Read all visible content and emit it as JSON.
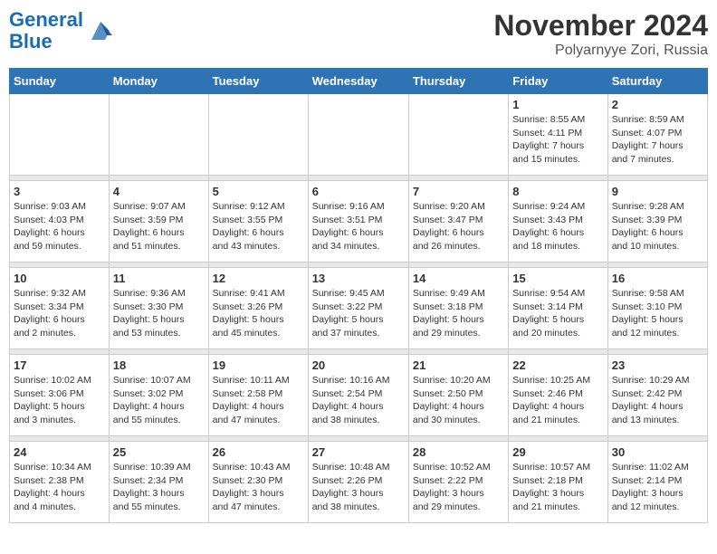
{
  "logo": {
    "line1": "General",
    "line2": "Blue"
  },
  "title": "November 2024",
  "location": "Polyarnyye Zori, Russia",
  "days_of_week": [
    "Sunday",
    "Monday",
    "Tuesday",
    "Wednesday",
    "Thursday",
    "Friday",
    "Saturday"
  ],
  "weeks": [
    [
      {
        "day": "",
        "info": ""
      },
      {
        "day": "",
        "info": ""
      },
      {
        "day": "",
        "info": ""
      },
      {
        "day": "",
        "info": ""
      },
      {
        "day": "",
        "info": ""
      },
      {
        "day": "1",
        "info": "Sunrise: 8:55 AM\nSunset: 4:11 PM\nDaylight: 7 hours\nand 15 minutes."
      },
      {
        "day": "2",
        "info": "Sunrise: 8:59 AM\nSunset: 4:07 PM\nDaylight: 7 hours\nand 7 minutes."
      }
    ],
    [
      {
        "day": "3",
        "info": "Sunrise: 9:03 AM\nSunset: 4:03 PM\nDaylight: 6 hours\nand 59 minutes."
      },
      {
        "day": "4",
        "info": "Sunrise: 9:07 AM\nSunset: 3:59 PM\nDaylight: 6 hours\nand 51 minutes."
      },
      {
        "day": "5",
        "info": "Sunrise: 9:12 AM\nSunset: 3:55 PM\nDaylight: 6 hours\nand 43 minutes."
      },
      {
        "day": "6",
        "info": "Sunrise: 9:16 AM\nSunset: 3:51 PM\nDaylight: 6 hours\nand 34 minutes."
      },
      {
        "day": "7",
        "info": "Sunrise: 9:20 AM\nSunset: 3:47 PM\nDaylight: 6 hours\nand 26 minutes."
      },
      {
        "day": "8",
        "info": "Sunrise: 9:24 AM\nSunset: 3:43 PM\nDaylight: 6 hours\nand 18 minutes."
      },
      {
        "day": "9",
        "info": "Sunrise: 9:28 AM\nSunset: 3:39 PM\nDaylight: 6 hours\nand 10 minutes."
      }
    ],
    [
      {
        "day": "10",
        "info": "Sunrise: 9:32 AM\nSunset: 3:34 PM\nDaylight: 6 hours\nand 2 minutes."
      },
      {
        "day": "11",
        "info": "Sunrise: 9:36 AM\nSunset: 3:30 PM\nDaylight: 5 hours\nand 53 minutes."
      },
      {
        "day": "12",
        "info": "Sunrise: 9:41 AM\nSunset: 3:26 PM\nDaylight: 5 hours\nand 45 minutes."
      },
      {
        "day": "13",
        "info": "Sunrise: 9:45 AM\nSunset: 3:22 PM\nDaylight: 5 hours\nand 37 minutes."
      },
      {
        "day": "14",
        "info": "Sunrise: 9:49 AM\nSunset: 3:18 PM\nDaylight: 5 hours\nand 29 minutes."
      },
      {
        "day": "15",
        "info": "Sunrise: 9:54 AM\nSunset: 3:14 PM\nDaylight: 5 hours\nand 20 minutes."
      },
      {
        "day": "16",
        "info": "Sunrise: 9:58 AM\nSunset: 3:10 PM\nDaylight: 5 hours\nand 12 minutes."
      }
    ],
    [
      {
        "day": "17",
        "info": "Sunrise: 10:02 AM\nSunset: 3:06 PM\nDaylight: 5 hours\nand 3 minutes."
      },
      {
        "day": "18",
        "info": "Sunrise: 10:07 AM\nSunset: 3:02 PM\nDaylight: 4 hours\nand 55 minutes."
      },
      {
        "day": "19",
        "info": "Sunrise: 10:11 AM\nSunset: 2:58 PM\nDaylight: 4 hours\nand 47 minutes."
      },
      {
        "day": "20",
        "info": "Sunrise: 10:16 AM\nSunset: 2:54 PM\nDaylight: 4 hours\nand 38 minutes."
      },
      {
        "day": "21",
        "info": "Sunrise: 10:20 AM\nSunset: 2:50 PM\nDaylight: 4 hours\nand 30 minutes."
      },
      {
        "day": "22",
        "info": "Sunrise: 10:25 AM\nSunset: 2:46 PM\nDaylight: 4 hours\nand 21 minutes."
      },
      {
        "day": "23",
        "info": "Sunrise: 10:29 AM\nSunset: 2:42 PM\nDaylight: 4 hours\nand 13 minutes."
      }
    ],
    [
      {
        "day": "24",
        "info": "Sunrise: 10:34 AM\nSunset: 2:38 PM\nDaylight: 4 hours\nand 4 minutes."
      },
      {
        "day": "25",
        "info": "Sunrise: 10:39 AM\nSunset: 2:34 PM\nDaylight: 3 hours\nand 55 minutes."
      },
      {
        "day": "26",
        "info": "Sunrise: 10:43 AM\nSunset: 2:30 PM\nDaylight: 3 hours\nand 47 minutes."
      },
      {
        "day": "27",
        "info": "Sunrise: 10:48 AM\nSunset: 2:26 PM\nDaylight: 3 hours\nand 38 minutes."
      },
      {
        "day": "28",
        "info": "Sunrise: 10:52 AM\nSunset: 2:22 PM\nDaylight: 3 hours\nand 29 minutes."
      },
      {
        "day": "29",
        "info": "Sunrise: 10:57 AM\nSunset: 2:18 PM\nDaylight: 3 hours\nand 21 minutes."
      },
      {
        "day": "30",
        "info": "Sunrise: 11:02 AM\nSunset: 2:14 PM\nDaylight: 3 hours\nand 12 minutes."
      }
    ]
  ]
}
